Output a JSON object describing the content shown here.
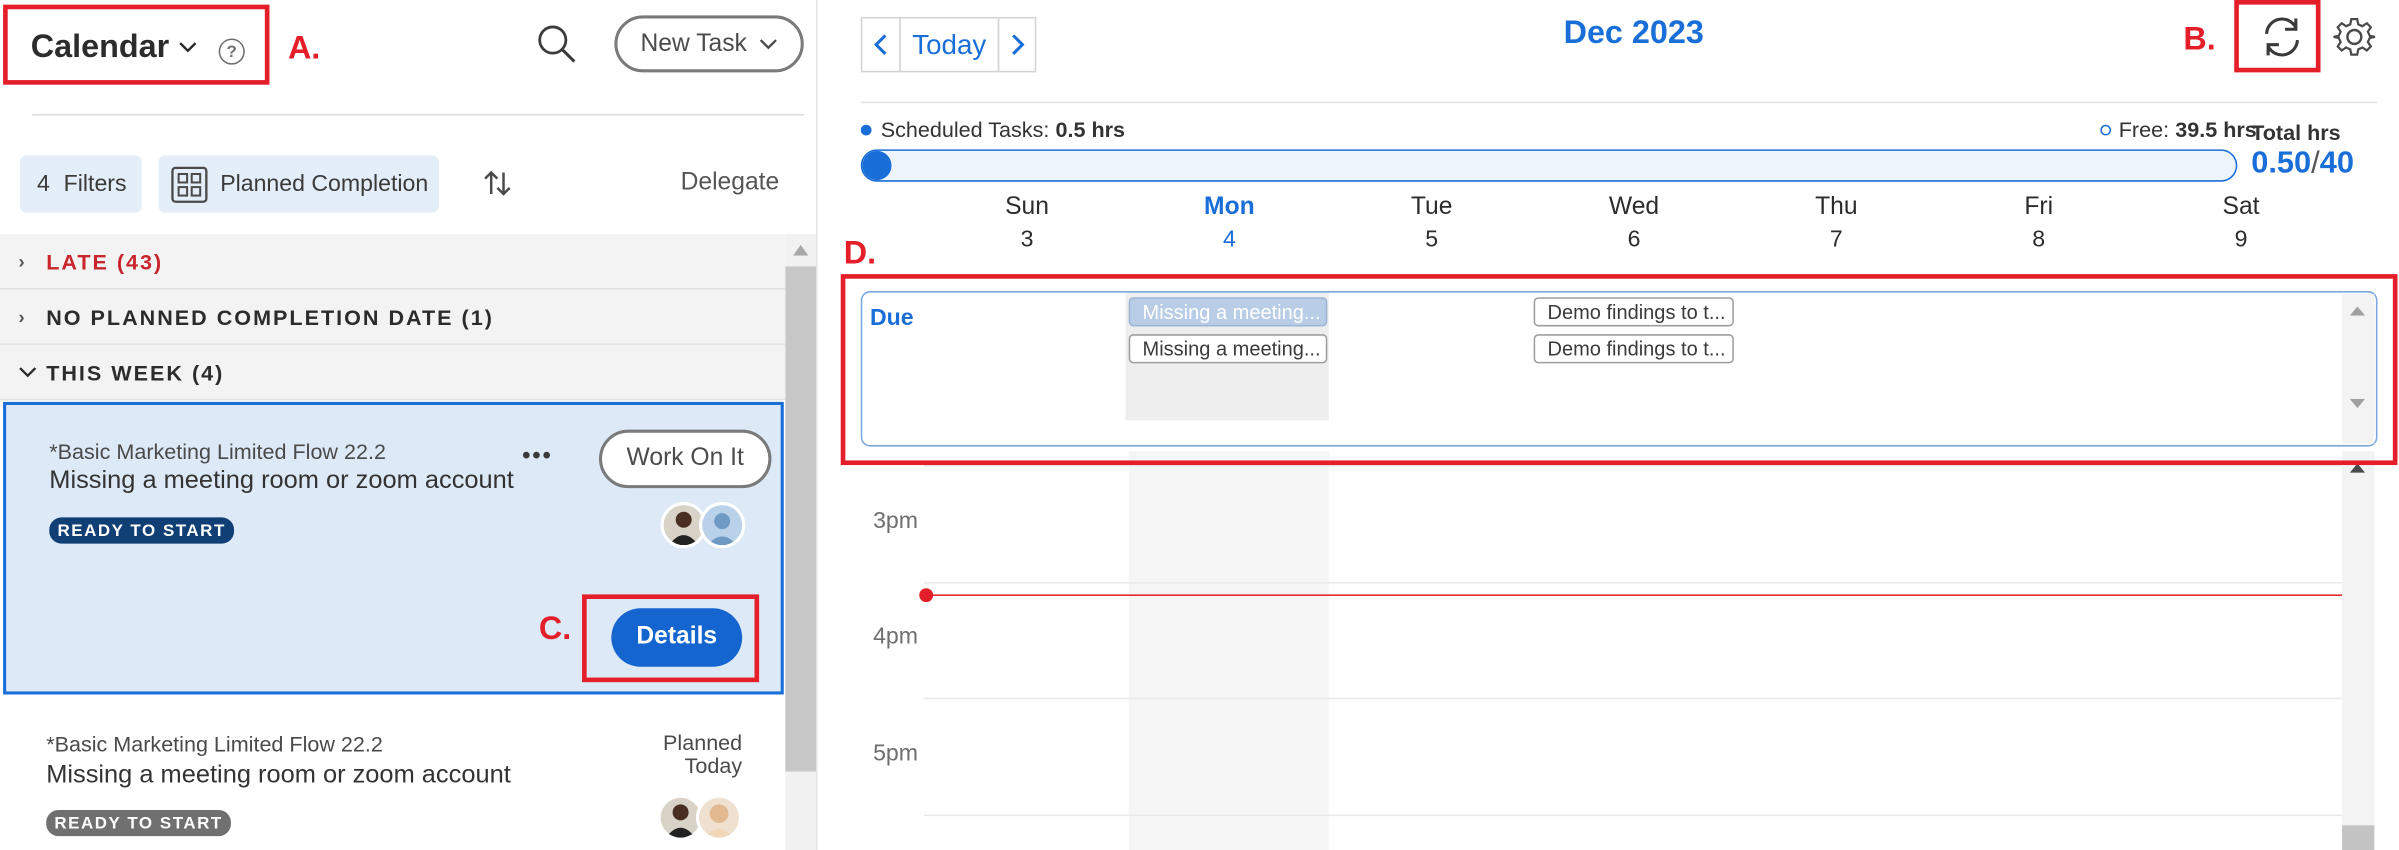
{
  "header": {
    "calendar_title": "Calendar",
    "help_icon": "?",
    "new_task_label": "New Task"
  },
  "filters": {
    "filter_count": "4",
    "filters_label": "Filters",
    "planned_completion_label": "Planned Completion",
    "delegate_label": "Delegate"
  },
  "groups": [
    {
      "label": "LATE (43)",
      "color": "#c9252c",
      "expanded": false
    },
    {
      "label": "NO PLANNED COMPLETION DATE (1)",
      "color": "#2c2c2c",
      "expanded": false
    },
    {
      "label": "THIS WEEK (4)",
      "color": "#2c2c2c",
      "expanded": true
    }
  ],
  "tasks": [
    {
      "project": "*Basic Marketing Limited Flow 22.2",
      "name": "Missing a meeting room or zoom account",
      "status": "READY TO START",
      "status_color": "#0f3f74",
      "action_label": "Work On It",
      "more_label": "•••",
      "details_label": "Details",
      "selected": true
    },
    {
      "project": "*Basic Marketing Limited Flow 22.2",
      "name": "Missing a meeting room or zoom account",
      "status": "READY TO START",
      "status_color": "#707070",
      "planned_label": "Planned",
      "planned_value": "Today",
      "selected": false
    }
  ],
  "calendar": {
    "today_label": "Today",
    "month_label": "Dec 2023",
    "scheduled_label": "Scheduled Tasks:",
    "scheduled_value": "0.5 hrs",
    "free_label": "Free:",
    "free_value": "39.5 hrs",
    "total_label": "Total hrs",
    "total_scheduled": "0.50",
    "total_separator": "/",
    "total_capacity": "40",
    "scheduled_fraction": 0.0125,
    "days": [
      {
        "name": "Sun",
        "num": "3",
        "today": false
      },
      {
        "name": "Mon",
        "num": "4",
        "today": true
      },
      {
        "name": "Tue",
        "num": "5",
        "today": false
      },
      {
        "name": "Wed",
        "num": "6",
        "today": false
      },
      {
        "name": "Thu",
        "num": "7",
        "today": false
      },
      {
        "name": "Fri",
        "num": "8",
        "today": false
      },
      {
        "name": "Sat",
        "num": "9",
        "today": false
      }
    ],
    "due_label": "Due",
    "due_events": [
      {
        "day": "Mon",
        "title": "Missing a meeting...",
        "faded": true
      },
      {
        "day": "Mon",
        "title": "Missing a meeting...",
        "faded": false
      },
      {
        "day": "Wed",
        "title": "Demo findings to t...",
        "faded": false
      },
      {
        "day": "Wed",
        "title": "Demo findings to t...",
        "faded": false
      }
    ],
    "hours": [
      "3pm",
      "4pm",
      "5pm"
    ],
    "accent_color": "#1a6ed8",
    "now_line_color": "#e41f2a"
  },
  "annotations": {
    "a": "A.",
    "b": "B.",
    "c": "C.",
    "d": "D."
  },
  "icons": {
    "search": "search-icon",
    "sync": "sync-icon",
    "settings": "gear-icon",
    "sort": "sort-icon",
    "grid": "grid-icon"
  }
}
